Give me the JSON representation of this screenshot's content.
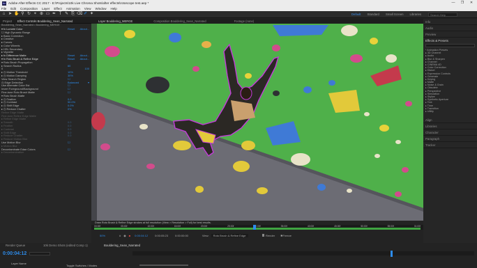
{
  "app": {
    "title": "Adobe After Effects CC 2017 - E:\\Projects\\10k Live Chroma Shots\\after effects\\rotoscope test.aep *",
    "window_controls": [
      "—",
      "❐",
      "✕"
    ],
    "menu": [
      "File",
      "Edit",
      "Composition",
      "Layer",
      "Effect",
      "Animation",
      "View",
      "Window",
      "Help"
    ],
    "workspaces": [
      {
        "label": "Default",
        "active": true
      },
      {
        "label": "Standard",
        "active": false
      },
      {
        "label": "Small Screen",
        "active": false
      },
      {
        "label": "Libraries",
        "active": false
      }
    ],
    "search_placeholder": "Search Help"
  },
  "effect_panel": {
    "tabs": [
      {
        "label": "Project",
        "active": false
      },
      {
        "label": "Effect Controls Bouldering_Sean_Narrated",
        "active": true
      }
    ],
    "layer_path": "Bouldering_Sean_Narrated • Bouldering_MERGE",
    "rows": [
      {
        "name": "▾ fx  Lumetri Color",
        "value": "Reset",
        "right": "About...",
        "type": "hdr"
      },
      {
        "name": "      ☐ High Dynamic Range",
        "value": "",
        "right": "",
        "type": "normal"
      },
      {
        "name": "  ▸ Basic Correction",
        "value": "",
        "right": "",
        "type": "normal"
      },
      {
        "name": "  ▸ Creative",
        "value": "",
        "right": "",
        "type": "normal"
      },
      {
        "name": "  ▸ Curves",
        "value": "",
        "right": "",
        "type": "normal"
      },
      {
        "name": "  ▸ Color Wheels",
        "value": "",
        "right": "",
        "type": "normal"
      },
      {
        "name": "  ▸ HSL Secondary",
        "value": "",
        "right": "",
        "type": "normal"
      },
      {
        "name": "  ▸ Vignette",
        "value": "",
        "right": "",
        "type": "normal"
      },
      {
        "name": "▸ fx  Difference Matte",
        "value": "Reset",
        "right": "About...",
        "type": "hdr"
      },
      {
        "name": "▾ fx  Roto Brush & Refine Edge",
        "value": "Reset",
        "right": "About...",
        "type": "hdr"
      },
      {
        "name": "  ▾ Roto Brush Propagation",
        "value": "",
        "right": "",
        "type": "normal"
      },
      {
        "name": "    ▸ Search Radius",
        "value": "60",
        "right": "",
        "type": "normal"
      },
      {
        "name": "           0",
        "value": "",
        "right": "100",
        "type": "normal"
      },
      {
        "name": "    ▸ ◷ Motion Threshold",
        "value": "10%",
        "right": "",
        "type": "normal"
      },
      {
        "name": "    ▸ ◷ Motion Damping",
        "value": "30%",
        "right": "",
        "type": "normal"
      },
      {
        "name": "       View Search Region",
        "value": "☐",
        "right": "",
        "type": "normal"
      },
      {
        "name": "    ◷ Edge Detection",
        "value": "Balanced",
        "right": "▾",
        "type": "normal"
      },
      {
        "name": "       Use Alternate Color Est",
        "value": "☐",
        "right": "",
        "type": "normal"
      },
      {
        "name": "  Invert Foreground/Background",
        "value": "☐",
        "right": "",
        "type": "normal"
      },
      {
        "name": "  Fine-tune Roto Brush Matte",
        "value": "☐",
        "right": "",
        "type": "normal"
      },
      {
        "name": "  ▾ Roto Brush Matte",
        "value": "",
        "right": "",
        "type": "normal"
      },
      {
        "name": "    ▸ ◷ Feather",
        "value": "0.0",
        "right": "",
        "type": "normal"
      },
      {
        "name": "    ▸ ◷ Contrast",
        "value": "50.0%",
        "right": "",
        "type": "normal"
      },
      {
        "name": "    ▸ ◷ Shift Edge",
        "value": "0.0%",
        "right": "",
        "type": "normal"
      },
      {
        "name": "    ▸ ◷ Reduce Chatter",
        "value": "0%",
        "right": "",
        "type": "normal"
      },
      {
        "name": "  Refine Edge Matte",
        "value": "",
        "right": "",
        "type": "dim"
      },
      {
        "name": "  Fine-tune Refine Edge Matte",
        "value": "",
        "right": "",
        "type": "dim"
      },
      {
        "name": "  ▸ Refine Edge Matte",
        "value": "",
        "right": "",
        "type": "dim"
      },
      {
        "name": "    ▸ Smooth",
        "value": "0.0",
        "right": "",
        "type": "dim"
      },
      {
        "name": "    ▸ Feather",
        "value": "0.0",
        "right": "",
        "type": "dim"
      },
      {
        "name": "    ▸ Contrast",
        "value": "0.0",
        "right": "",
        "type": "dim"
      },
      {
        "name": "    ▸ Shift Edge",
        "value": "0.0",
        "right": "",
        "type": "dim"
      },
      {
        "name": "    ▸ Reduce Chatter",
        "value": "0.0",
        "right": "",
        "type": "dim"
      },
      {
        "name": "    ▸ Reduce Motion Blur",
        "value": "",
        "right": "",
        "type": "dim"
      },
      {
        "name": "  Use Motion Blur",
        "value": "☐",
        "right": "",
        "type": "normal"
      },
      {
        "name": "  ▸ Motion Blur",
        "value": "",
        "right": "",
        "type": "dim"
      },
      {
        "name": "  Decontaminate Edge Colors",
        "value": "☐",
        "right": "",
        "type": "normal"
      },
      {
        "name": "  ▸ Decontamination",
        "value": "",
        "right": "",
        "type": "dim"
      }
    ]
  },
  "viewer": {
    "tabs": [
      "Layer Bouldering_MERGE",
      "Composition Bouldering_Sean_Narrated",
      "Footage (none)"
    ],
    "status_message": "Draw Roto Brush & Refine Edge strokes at full resolution (View > Resolution > Full) for best results.",
    "ruler_ticks": [
      "00:00f",
      "05:00f",
      "10:00f",
      "15:00f",
      "20:00f",
      "25:00f",
      "30:00f",
      "35:00f",
      "40:00f",
      "45:00f",
      "50:00f",
      "55:00f",
      "01:00f"
    ],
    "footer": {
      "zoom": "50%",
      "timecode": "0:00:04:12",
      "duration": "0:00:05:23",
      "timecode2": "0:00:00:00",
      "resolution": "Full",
      "view_label": "View:",
      "view_value": "Roto Brush & Refine Edge",
      "render_label": "Render",
      "freeze_label": "Freeze"
    }
  },
  "right_panel": {
    "top_items": [
      "Info",
      "Audio",
      "Preview"
    ],
    "effects_title": "Effects & Presets",
    "effects_list": [
      "* Animation Presets",
      "▸ 3D Channel",
      "▸ Audio",
      "▸ Blur & Sharpen",
      "▸ Channel",
      "▸ CINEMA 4D",
      "▸ Color Correction",
      "▸ Distort",
      "▸ Expression Controls",
      "▸ Generate",
      "▸ Keying",
      "▸ Matte",
      "▸ Noise & Grain",
      "▸ Obsolete",
      "▸ Perspective",
      "▸ Simulation",
      "▸ Stylize",
      "▸ Synthetic Aperture",
      "▸ Text",
      "▸ Time",
      "▸ Transition",
      "▸ Utility"
    ],
    "bottom_items": [
      "Align",
      "Libraries",
      "Character",
      "Paragraph",
      "Tracker"
    ]
  },
  "timeline": {
    "tabs": [
      "Render Queue",
      "10k Demo Shots (edited Comp 1)",
      "Bouldering_Sean_Narrated"
    ],
    "timecode": "0:00:04:12",
    "layer_label": "Layer Name",
    "toggle_label": "Toggle Switches / Modes"
  },
  "colors": {
    "accent": "#2d8ceb",
    "green_screen": "#4fb04a",
    "timecode": "#2d8ceb"
  }
}
